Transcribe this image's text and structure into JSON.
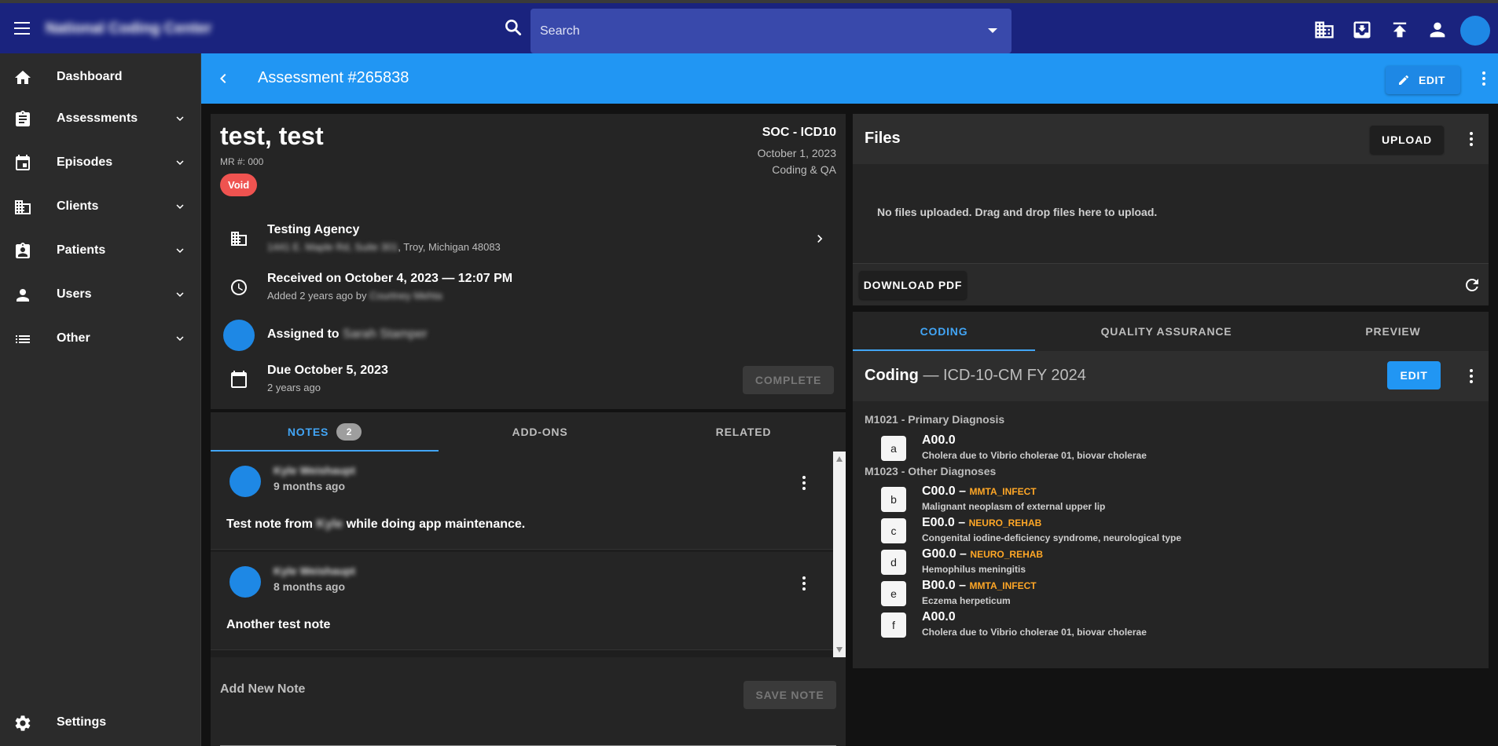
{
  "app": {
    "brand": "National Coding Center"
  },
  "search": {
    "placeholder": "Search"
  },
  "sidebar": {
    "items": [
      {
        "label": "Dashboard"
      },
      {
        "label": "Assessments"
      },
      {
        "label": "Episodes"
      },
      {
        "label": "Clients"
      },
      {
        "label": "Patients"
      },
      {
        "label": "Users"
      },
      {
        "label": "Other"
      }
    ],
    "settings": "Settings"
  },
  "header": {
    "title": "Assessment #265838",
    "edit_label": "EDIT"
  },
  "patient": {
    "name": "test, test",
    "mr": "MR #: 000",
    "status": "Void",
    "assessment_type": "SOC - ICD10",
    "date": "October 1, 2023",
    "service": "Coding & QA",
    "agency": "Testing Agency",
    "agency_street": "1441 E. Maple Rd, Suite 301",
    "agency_city": ", Troy, Michigan 48083",
    "received": "Received on October 4, 2023 — 12:07 PM",
    "added": "Added 2 years ago by",
    "added_by": "Courtney Mehta",
    "assigned_prefix": "Assigned to",
    "assignee": "Sarah Stamper",
    "due": "Due October 5, 2023",
    "due_ago": "2 years ago",
    "complete_label": "COMPLETE"
  },
  "notes": {
    "tabs": {
      "notes": "NOTES",
      "notes_count": "2",
      "addons": "ADD-ONS",
      "related": "RELATED"
    },
    "items": [
      {
        "author": "Kyle Weishaupt",
        "time": "9 months ago",
        "text_a": "Test note from",
        "text_name": "Kyle",
        "text_b": "while doing app maintenance."
      },
      {
        "author": "Kyle Weishaupt",
        "time": "8 months ago",
        "text": "Another test note"
      }
    ],
    "add_label": "Add New Note",
    "save_label": "SAVE NOTE"
  },
  "files": {
    "title": "Files",
    "upload_label": "UPLOAD",
    "empty": "No files uploaded. Drag and drop files here to upload.",
    "download_label": "DOWNLOAD PDF"
  },
  "coding": {
    "tabs": [
      "CODING",
      "QUALITY ASSURANCE",
      "PREVIEW"
    ],
    "title": "Coding",
    "subtitle": "— ICD-10-CM FY 2024",
    "edit_label": "EDIT",
    "primary_title": "M1021 - Primary Diagnosis",
    "other_title": "M1023 - Other Diagnoses",
    "diagnoses": [
      {
        "letter": "a",
        "code": "A00.0",
        "tag": "",
        "desc": "Cholera due to Vibrio cholerae 01, biovar cholerae"
      },
      {
        "letter": "b",
        "code": "C00.0",
        "tag": "MMTA_INFECT",
        "desc": "Malignant neoplasm of external upper lip"
      },
      {
        "letter": "c",
        "code": "E00.0",
        "tag": "NEURO_REHAB",
        "desc": "Congenital iodine-deficiency syndrome, neurological type"
      },
      {
        "letter": "d",
        "code": "G00.0",
        "tag": "NEURO_REHAB",
        "desc": "Hemophilus meningitis"
      },
      {
        "letter": "e",
        "code": "B00.0",
        "tag": "MMTA_INFECT",
        "desc": "Eczema herpeticum"
      },
      {
        "letter": "f",
        "code": "A00.0",
        "tag": "",
        "desc": "Cholera due to Vibrio cholerae 01, biovar cholerae"
      }
    ]
  },
  "colors": {
    "topbar": "#1a237e",
    "header": "#2196f3",
    "accent": "#42a5f5",
    "void": "#ef5350",
    "tag": "#ffa726"
  }
}
